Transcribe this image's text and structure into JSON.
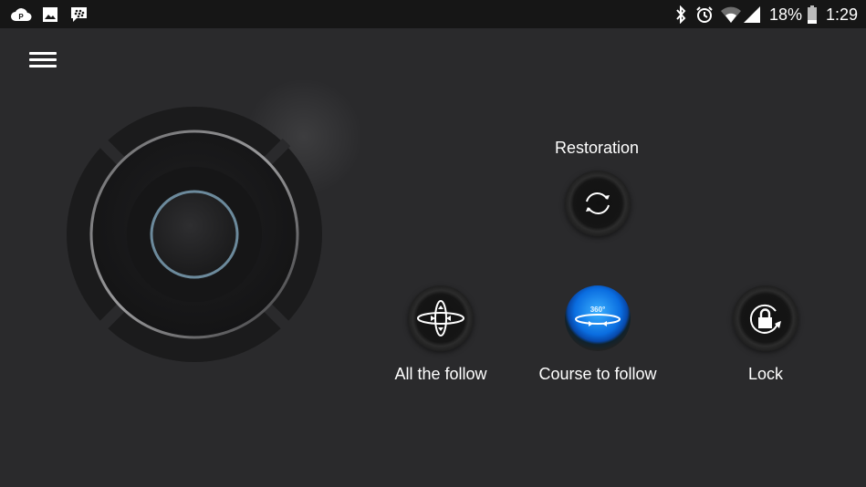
{
  "status_bar": {
    "left_icons": [
      "cloud-p-icon",
      "image-icon",
      "blackberry-messenger-icon"
    ],
    "right_icons": [
      "bluetooth-icon",
      "alarm-icon",
      "wifi-icon",
      "cellular-signal-icon"
    ],
    "battery_percent": "18%",
    "battery_icon": "battery-icon",
    "time": "1:29"
  },
  "menu": {
    "icon": "hamburger-menu-icon"
  },
  "joystick": {
    "name": "gimbal-joystick"
  },
  "controls": {
    "restoration": {
      "label": "Restoration",
      "icon": "refresh-cycle-icon"
    },
    "all_follow": {
      "label": "All the follow",
      "icon": "all-axis-follow-icon"
    },
    "course_follow": {
      "label": "Course to follow",
      "icon": "360-rotate-icon",
      "badge": "360°",
      "active": true,
      "active_color": "#1a7ff0"
    },
    "lock": {
      "label": "Lock",
      "icon": "lock-rotate-icon"
    }
  }
}
